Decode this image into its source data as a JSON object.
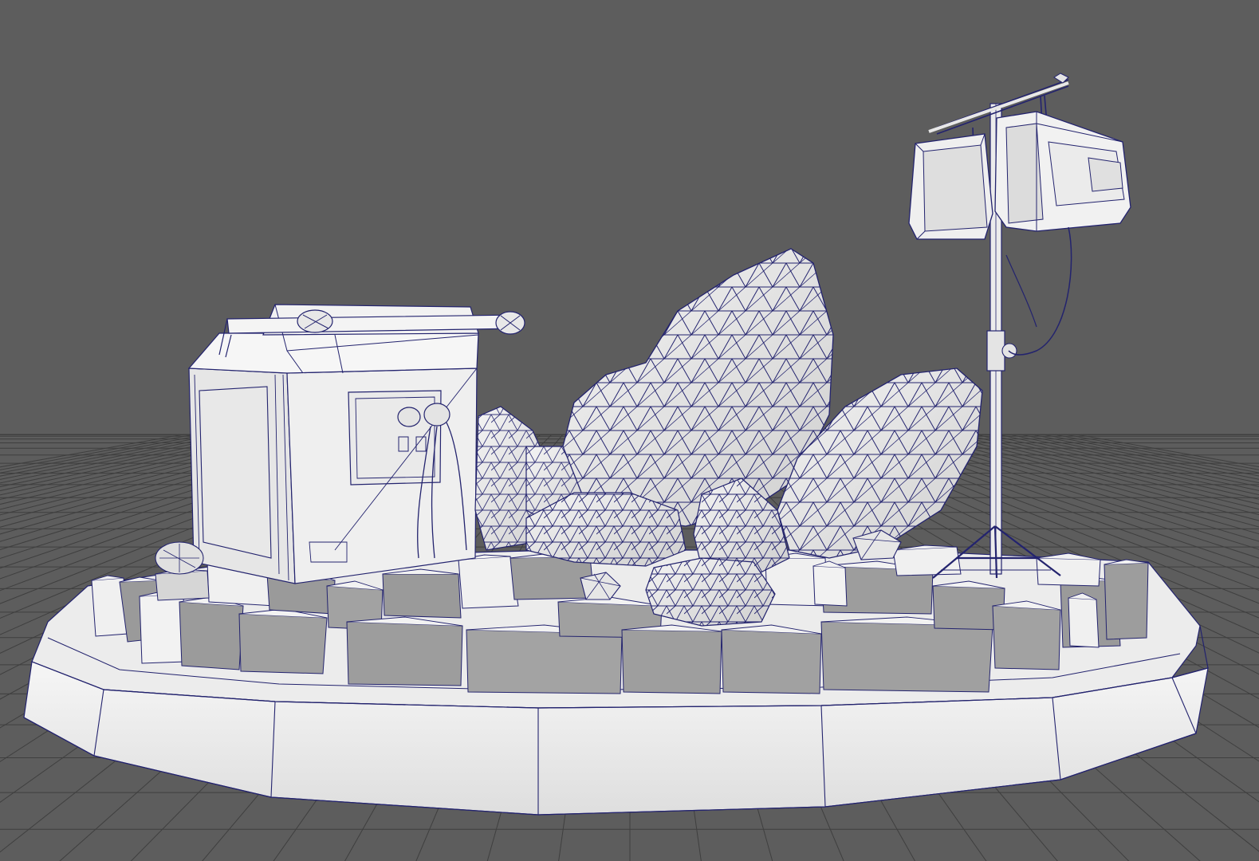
{
  "viewport": {
    "background_color": "#5d5d5d",
    "ground_grid": true,
    "grid_color": "#3f3f3f",
    "display_mode": "wireframe-on-shaded"
  },
  "colors": {
    "wire": "#23236e",
    "surface_light": "#f0f0f0",
    "surface_mid": "#d9d9d9",
    "surface_shadow": "#9a9a9a",
    "rubble_dark": "#8a8a8a"
  },
  "scene": {
    "objects": [
      {
        "name": "base-platform",
        "shape": "octagonal-pedestal"
      },
      {
        "name": "rubble-ring",
        "shape": "concrete-slab-ring"
      },
      {
        "name": "generator-crate",
        "shape": "box-with-handle-bar"
      },
      {
        "name": "crystal-rock-large",
        "shape": "triangulated-rock"
      },
      {
        "name": "crystal-rock-right",
        "shape": "triangulated-rock"
      },
      {
        "name": "small-rocks",
        "shape": "triangulated-rock-cluster"
      },
      {
        "name": "floodlight-stand",
        "shape": "tripod-with-two-lamps"
      }
    ]
  }
}
